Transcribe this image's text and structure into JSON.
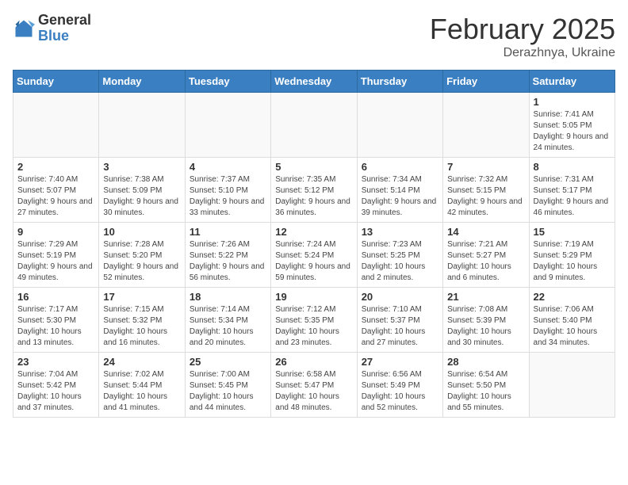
{
  "header": {
    "logo_general": "General",
    "logo_blue": "Blue",
    "month_title": "February 2025",
    "subtitle": "Derazhnya, Ukraine"
  },
  "weekdays": [
    "Sunday",
    "Monday",
    "Tuesday",
    "Wednesday",
    "Thursday",
    "Friday",
    "Saturday"
  ],
  "weeks": [
    [
      {
        "day": "",
        "info": ""
      },
      {
        "day": "",
        "info": ""
      },
      {
        "day": "",
        "info": ""
      },
      {
        "day": "",
        "info": ""
      },
      {
        "day": "",
        "info": ""
      },
      {
        "day": "",
        "info": ""
      },
      {
        "day": "1",
        "info": "Sunrise: 7:41 AM\nSunset: 5:05 PM\nDaylight: 9 hours and 24 minutes."
      }
    ],
    [
      {
        "day": "2",
        "info": "Sunrise: 7:40 AM\nSunset: 5:07 PM\nDaylight: 9 hours and 27 minutes."
      },
      {
        "day": "3",
        "info": "Sunrise: 7:38 AM\nSunset: 5:09 PM\nDaylight: 9 hours and 30 minutes."
      },
      {
        "day": "4",
        "info": "Sunrise: 7:37 AM\nSunset: 5:10 PM\nDaylight: 9 hours and 33 minutes."
      },
      {
        "day": "5",
        "info": "Sunrise: 7:35 AM\nSunset: 5:12 PM\nDaylight: 9 hours and 36 minutes."
      },
      {
        "day": "6",
        "info": "Sunrise: 7:34 AM\nSunset: 5:14 PM\nDaylight: 9 hours and 39 minutes."
      },
      {
        "day": "7",
        "info": "Sunrise: 7:32 AM\nSunset: 5:15 PM\nDaylight: 9 hours and 42 minutes."
      },
      {
        "day": "8",
        "info": "Sunrise: 7:31 AM\nSunset: 5:17 PM\nDaylight: 9 hours and 46 minutes."
      }
    ],
    [
      {
        "day": "9",
        "info": "Sunrise: 7:29 AM\nSunset: 5:19 PM\nDaylight: 9 hours and 49 minutes."
      },
      {
        "day": "10",
        "info": "Sunrise: 7:28 AM\nSunset: 5:20 PM\nDaylight: 9 hours and 52 minutes."
      },
      {
        "day": "11",
        "info": "Sunrise: 7:26 AM\nSunset: 5:22 PM\nDaylight: 9 hours and 56 minutes."
      },
      {
        "day": "12",
        "info": "Sunrise: 7:24 AM\nSunset: 5:24 PM\nDaylight: 9 hours and 59 minutes."
      },
      {
        "day": "13",
        "info": "Sunrise: 7:23 AM\nSunset: 5:25 PM\nDaylight: 10 hours and 2 minutes."
      },
      {
        "day": "14",
        "info": "Sunrise: 7:21 AM\nSunset: 5:27 PM\nDaylight: 10 hours and 6 minutes."
      },
      {
        "day": "15",
        "info": "Sunrise: 7:19 AM\nSunset: 5:29 PM\nDaylight: 10 hours and 9 minutes."
      }
    ],
    [
      {
        "day": "16",
        "info": "Sunrise: 7:17 AM\nSunset: 5:30 PM\nDaylight: 10 hours and 13 minutes."
      },
      {
        "day": "17",
        "info": "Sunrise: 7:15 AM\nSunset: 5:32 PM\nDaylight: 10 hours and 16 minutes."
      },
      {
        "day": "18",
        "info": "Sunrise: 7:14 AM\nSunset: 5:34 PM\nDaylight: 10 hours and 20 minutes."
      },
      {
        "day": "19",
        "info": "Sunrise: 7:12 AM\nSunset: 5:35 PM\nDaylight: 10 hours and 23 minutes."
      },
      {
        "day": "20",
        "info": "Sunrise: 7:10 AM\nSunset: 5:37 PM\nDaylight: 10 hours and 27 minutes."
      },
      {
        "day": "21",
        "info": "Sunrise: 7:08 AM\nSunset: 5:39 PM\nDaylight: 10 hours and 30 minutes."
      },
      {
        "day": "22",
        "info": "Sunrise: 7:06 AM\nSunset: 5:40 PM\nDaylight: 10 hours and 34 minutes."
      }
    ],
    [
      {
        "day": "23",
        "info": "Sunrise: 7:04 AM\nSunset: 5:42 PM\nDaylight: 10 hours and 37 minutes."
      },
      {
        "day": "24",
        "info": "Sunrise: 7:02 AM\nSunset: 5:44 PM\nDaylight: 10 hours and 41 minutes."
      },
      {
        "day": "25",
        "info": "Sunrise: 7:00 AM\nSunset: 5:45 PM\nDaylight: 10 hours and 44 minutes."
      },
      {
        "day": "26",
        "info": "Sunrise: 6:58 AM\nSunset: 5:47 PM\nDaylight: 10 hours and 48 minutes."
      },
      {
        "day": "27",
        "info": "Sunrise: 6:56 AM\nSunset: 5:49 PM\nDaylight: 10 hours and 52 minutes."
      },
      {
        "day": "28",
        "info": "Sunrise: 6:54 AM\nSunset: 5:50 PM\nDaylight: 10 hours and 55 minutes."
      },
      {
        "day": "",
        "info": ""
      }
    ]
  ]
}
